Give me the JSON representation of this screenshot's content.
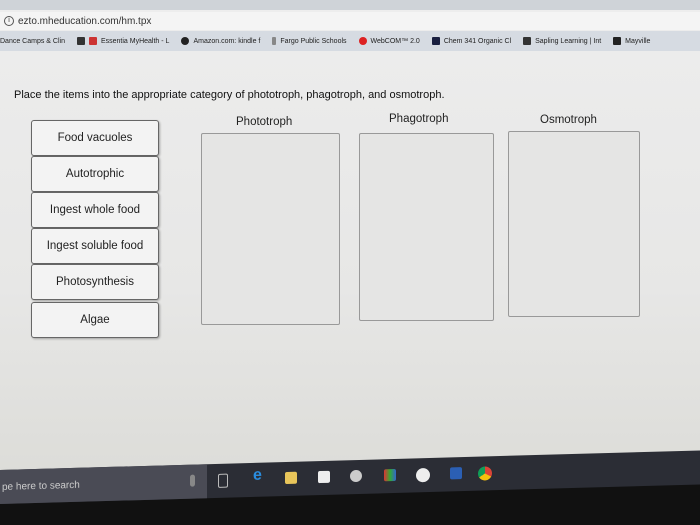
{
  "browser": {
    "url": "ezto.mheducation.com/hm.tpx",
    "bookmarks": [
      "Dance Camps & Clin",
      "Essentia MyHealth - L",
      "Amazon.com: kindle f",
      "Fargo Public Schools",
      "WebCOM™ 2.0",
      "Chem 341 Organic Cl",
      "Sapling Learning | Int",
      "Mayville"
    ]
  },
  "question": "Place the items into the appropriate category of phototroph, phagotroph, and osmotroph.",
  "items": [
    "Food vacuoles",
    "Autotrophic",
    "Ingest whole food",
    "Ingest soluble food",
    "Photosynthesis",
    "Algae"
  ],
  "categories": [
    "Phototroph",
    "Phagotroph",
    "Osmotroph"
  ],
  "taskbar": {
    "search_placeholder": "pe here to search",
    "icons": [
      "mic-icon",
      "task-view-icon",
      "edge-icon",
      "file-explorer-icon",
      "store-icon",
      "camera-icon",
      "app-icon",
      "hp-icon",
      "word-icon",
      "chrome-icon"
    ]
  }
}
